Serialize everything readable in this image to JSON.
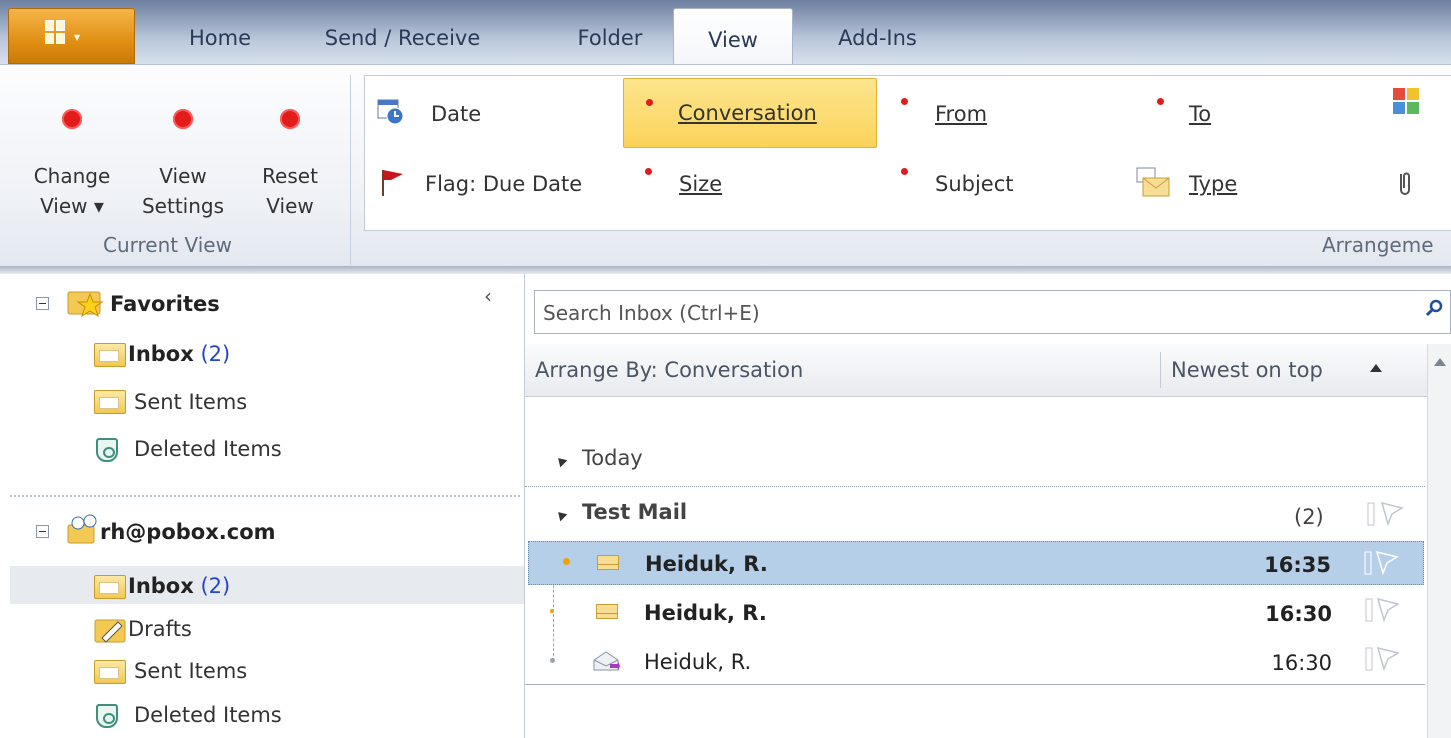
{
  "tabs": {
    "file_caret": "▾",
    "items": [
      "Home",
      "Send / Receive",
      "Folder",
      "View",
      "Add-Ins"
    ],
    "active": "View"
  },
  "current_view": {
    "change_view": [
      "Change",
      "View ▾"
    ],
    "view_settings": [
      "View",
      "Settings"
    ],
    "reset_view": [
      "Reset",
      "View"
    ],
    "group_label": "Current View"
  },
  "arrangement": {
    "items": {
      "date": "Date",
      "conversation": "Conversation",
      "from": "From",
      "to": "To",
      "flag_due_date": "Flag: Due Date",
      "size": "Size",
      "subject": "Subject",
      "type": "Type"
    },
    "selected": "Conversation",
    "group_label": "Arrangeme"
  },
  "nav": {
    "favorites": {
      "label": "Favorites",
      "folders": [
        {
          "name": "Inbox",
          "count": "(2)"
        },
        {
          "name": "Sent Items"
        },
        {
          "name": "Deleted Items"
        }
      ]
    },
    "account": {
      "label": "rh@pobox.com",
      "folders": [
        {
          "name": "Inbox",
          "count": "(2)"
        },
        {
          "name": "Drafts"
        },
        {
          "name": "Sent Items"
        },
        {
          "name": "Deleted Items"
        }
      ]
    },
    "collapse_glyph": "‹"
  },
  "mail_list": {
    "search_placeholder": "Search Inbox (Ctrl+E)",
    "arrange_by": "Arrange By: Conversation",
    "sort_order": "Newest on top",
    "group": "Today",
    "conversation": {
      "subject": "Test Mail",
      "count": "(2)"
    },
    "messages": [
      {
        "sender": "Heiduk, R.",
        "time": "16:35",
        "unread": true,
        "selected": true
      },
      {
        "sender": "Heiduk, R.",
        "time": "16:30",
        "unread": true,
        "selected": false
      },
      {
        "sender": "Heiduk, R.",
        "time": "16:30",
        "unread": false,
        "selected": false
      }
    ]
  },
  "colors": {
    "accent_file": "#e08f12",
    "selection": "#b5cfe9",
    "arrangement_selected": "#fbd35a",
    "count_blue": "#2447c8",
    "red_dot": "#e21b1b"
  }
}
